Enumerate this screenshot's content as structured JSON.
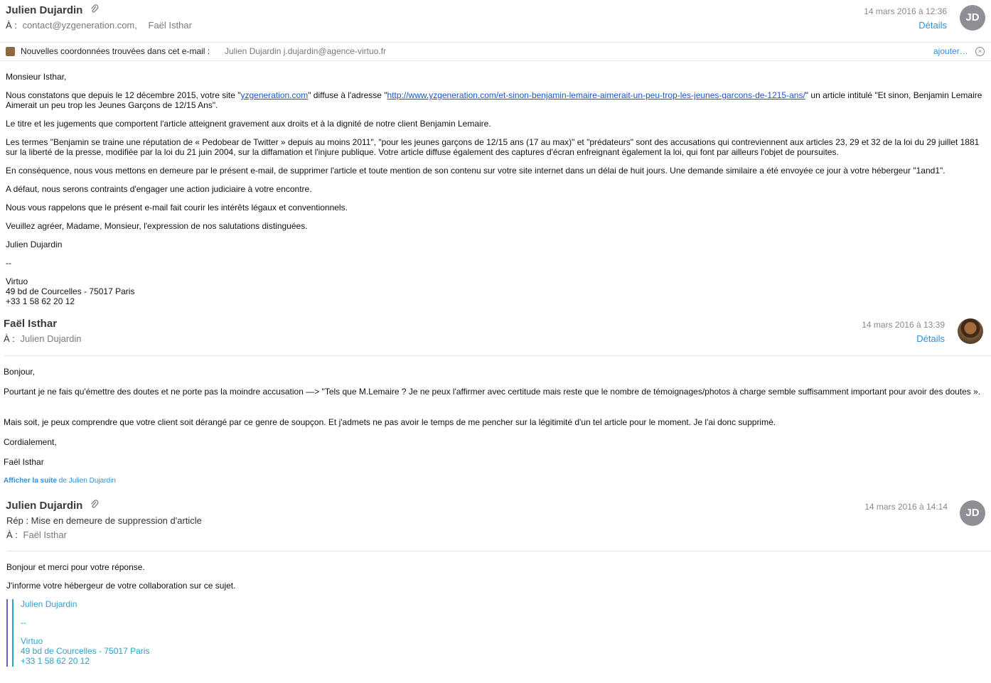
{
  "msg1": {
    "sender": "Julien Dujardin",
    "to_label": "À :",
    "to": "contact@yzgeneration.com,",
    "to2": "Faël Isthar",
    "date": "14 mars 2016 à 12:36",
    "details": "Détails",
    "avatar": "JD",
    "attachment_icon": "paperclip-icon"
  },
  "contact_bar": {
    "text": "Nouvelles coordonnées trouvées dans cet e-mail :",
    "contact": "Julien Dujardin j.dujardin@agence-virtuo.fr",
    "add": "ajouter…",
    "close": "×"
  },
  "body1": {
    "greeting": "Monsieur Isthar,",
    "p1a": "Nous constatons que depuis le 12 décembre 2015, votre site \"",
    "p1_site": "yzgeneration.com",
    "p1b": "\" diffuse à l'adresse \"",
    "p1_url": "http://www.yzgeneration.com/et-sinon-benjamin-lemaire-aimerait-un-peu-trop-les-jeunes-garcons-de-1215-ans/",
    "p1c": "\" un article intitulé \"Et sinon, Benjamin Lemaire Aimerait un peu trop les Jeunes Garçons de 12/15 Ans\".",
    "p2": "Le titre et les jugements que comportent l'article atteignent gravement aux droits et à la dignité de notre client Benjamin Lemaire.",
    "p3": "Les termes \"Benjamin se traine une réputation de « Pedobear de Twitter » depuis au moins 2011\", \"pour les jeunes garçons de 12/15 ans (17 au max)\" et \"prédateurs\" sont des accusations qui contreviennent aux articles 23, 29 et 32 de la loi du 29 juillet 1881 sur la liberté de la presse, modifiée par la loi du 21 juin 2004, sur la diffamation et l'injure publique. Votre article diffuse également des captures d'écran enfreignant également la loi, qui font par ailleurs l'objet de poursuites.",
    "p4": "En conséquence, nous vous mettons en demeure par le présent e-mail, de supprimer l'article et toute mention de son contenu sur votre site internet dans un délai de huit jours. Une demande similaire a été envoyée ce jour à votre hébergeur \"1and1\".",
    "p5": "A défaut, nous serons contraints d'engager une action judiciaire à votre encontre.",
    "p6": "Nous vous rappelons que le présent e-mail fait courir les intérêts légaux et conventionnels.",
    "p7": "Veuillez agréer, Madame, Monsieur, l'expression de nos salutations distinguées.",
    "sign": "Julien Dujardin",
    "dash": "--",
    "company": "Virtuo",
    "address": "49 bd de Courcelles - 75017 Paris",
    "phone": "+33 1 58 62 20 12"
  },
  "msg2": {
    "sender": "Faël Isthar",
    "to_label": "À :",
    "to": "Julien Dujardin",
    "date": "14 mars 2016 à 13:39",
    "details": "Détails"
  },
  "body2": {
    "greeting": "Bonjour,",
    "p1": "Pourtant je ne fais qu'émettre des doutes et ne porte pas la moindre accusation —> \"Tels que M.Lemaire ? Je ne peux l'affirmer avec certitude mais reste que le nombre de témoignages/photos à charge semble suffisamment important pour avoir des doutes ».",
    "p2": "Mais soit, je peux comprendre que votre client soit dérangé par ce genre de soupçon.  Et j'admets ne pas avoir le temps de me pencher sur la légitimité d'un tel article pour le moment. Je l'ai donc supprimé.",
    "closing": "Cordialement,",
    "sign": "Faël Isthar",
    "showmore_bold": "Afficher la suite",
    "showmore_rest": " de Julien Dujardin"
  },
  "msg3": {
    "sender": "Julien Dujardin",
    "subject": "Rép : Mise en demeure de suppression d'article",
    "to_label": "À :",
    "to": "Faël Isthar",
    "date": "14 mars 2016 à 14:14",
    "avatar": "JD"
  },
  "body3": {
    "p1": "Bonjour et merci pour votre réponse.",
    "p2": "J'informe votre hébergeur de votre collaboration sur ce sujet.",
    "q_sign": "Julien Dujardin",
    "q_dash": "--",
    "q_company": "Virtuo",
    "q_address": "49 bd de Courcelles - 75017 Paris",
    "q_phone": "+33 1 58 62 20 12"
  }
}
